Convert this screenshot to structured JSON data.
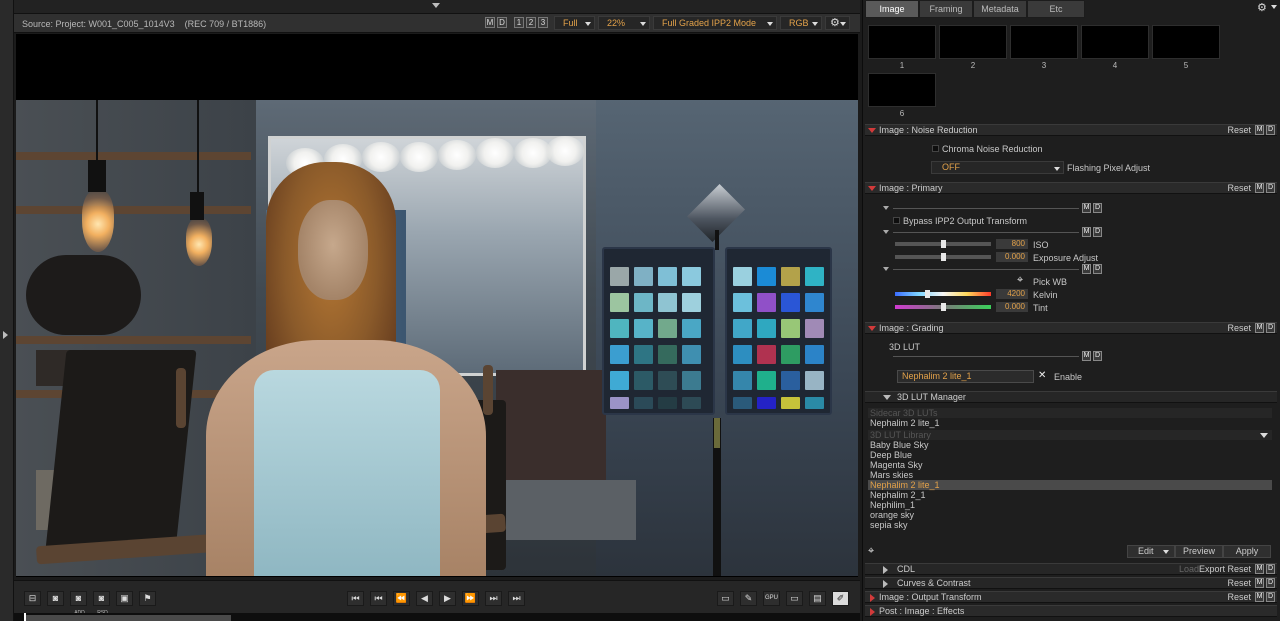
{
  "viewer": {
    "source_label": "Source: Project: W001_C005_1014V3",
    "color_label": "(REC 709 / BT1886)",
    "m_label": "M",
    "d_label": "D",
    "view1": "1",
    "view2": "2",
    "view3": "3",
    "resolution": "Full",
    "zoom": "22%",
    "mode": "Full Graded IPP2 Mode",
    "channel": "RGB"
  },
  "transport": {
    "add_label": "ADD",
    "rsd_label": "RSD",
    "playback_position": 0.25
  },
  "tabs": [
    "Image",
    "Framing",
    "Metadata",
    "Etc"
  ],
  "active_tab": "Image",
  "thumbnails": [
    "1",
    "2",
    "3",
    "4",
    "5",
    "6"
  ],
  "noise_reduction": {
    "title": "Image : Noise Reduction",
    "reset": "Reset",
    "chroma_label": "Chroma Noise Reduction",
    "flashing_value": "OFF",
    "flashing_label": "Flashing Pixel Adjust"
  },
  "primary": {
    "title": "Image : Primary",
    "reset": "Reset",
    "bypass_label": "Bypass IPP2 Output Transform",
    "iso_value": "800",
    "iso_label": "ISO",
    "exposure_value": "0.000",
    "exposure_label": "Exposure Adjust",
    "pickwb_label": "Pick WB",
    "kelvin_value": "4200",
    "kelvin_label": "Kelvin",
    "tint_value": "0.000",
    "tint_label": "Tint"
  },
  "grading": {
    "title": "Image : Grading",
    "reset": "Reset",
    "lut_label": "3D LUT",
    "lut_value": "Nephalim 2 lite_1",
    "clear_label": "✕",
    "enable_label": "Enable"
  },
  "lut_manager": {
    "title": "3D LUT Manager",
    "sidecar_header": "Sidecar 3D LUTs",
    "sidecar_items": [
      "Nephalim 2 lite_1"
    ],
    "library_header": "3D LUT Library",
    "library_items": [
      "Baby Blue Sky",
      "Deep Blue",
      "Magenta Sky",
      "Mars skies",
      "Nephalim 2 lite_1",
      "Nephalim 2_1",
      "Nephilim_1",
      "orange sky",
      "sepia sky"
    ],
    "selected": "Nephalim 2 lite_1",
    "edit_label": "Edit",
    "preview_label": "Preview",
    "apply_label": "Apply"
  },
  "cdl": {
    "title": "CDL",
    "load_label": "Load",
    "export_label": "Export",
    "reset": "Reset"
  },
  "curves": {
    "title": "Curves & Contrast",
    "reset": "Reset"
  },
  "output": {
    "title": "Image : Output Transform",
    "reset": "Reset"
  },
  "effects": {
    "title": "Post : Image : Effects"
  },
  "colors": {
    "accent_orange": "#e3a24a",
    "section_red": "#d23a3a"
  }
}
